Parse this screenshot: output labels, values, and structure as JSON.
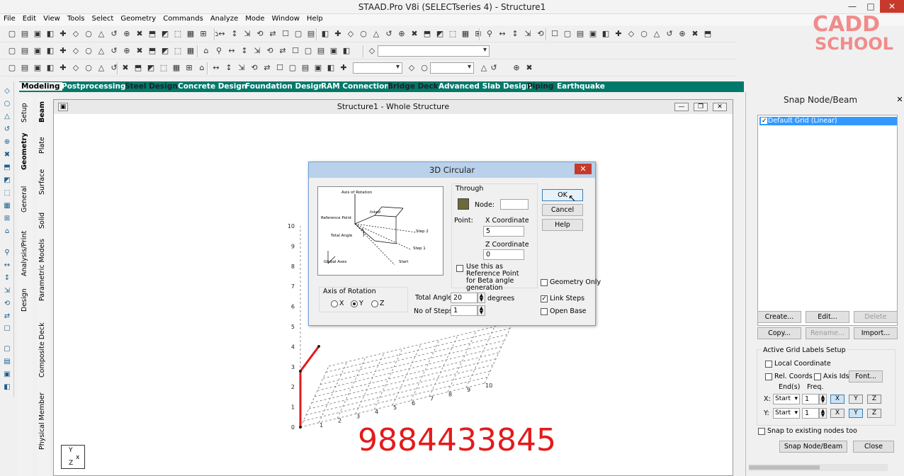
{
  "app": {
    "title": "STAAD.Pro V8i (SELECTseries 4) - Structure1"
  },
  "menu": [
    "File",
    "Edit",
    "View",
    "Tools",
    "Select",
    "Geometry",
    "Commands",
    "Analyze",
    "Mode",
    "Window",
    "Help"
  ],
  "logo": {
    "line1": "CADD",
    "line2": "SCHOOL"
  },
  "page_tabs": [
    "Modeling",
    "Postprocessing",
    "Steel Design",
    "Concrete Design",
    "Foundation Design",
    "RAM Connection",
    "Bridge Deck",
    "Advanced Slab Design",
    "Piping",
    "Earthquake"
  ],
  "side_tabs": {
    "outer": [
      "Setup",
      "Geometry",
      "General",
      "Analysis/Print",
      "Design"
    ],
    "inner": [
      "Beam",
      "Plate",
      "Surface",
      "Solid",
      "Parametric Models",
      "Composite Deck",
      "Physical Member"
    ]
  },
  "view": {
    "title": "Structure1 - Whole Structure",
    "y_axis_ticks": [
      "10",
      "9",
      "8",
      "7",
      "6",
      "5",
      "4",
      "3",
      "2",
      "1",
      "0"
    ],
    "x_axis_ticks": [
      "1",
      "2",
      "3",
      "4",
      "5",
      "6",
      "7",
      "8",
      "9",
      "10"
    ],
    "phone": "9884433845"
  },
  "dialog": {
    "title": "3D Circular",
    "diagram_labels": {
      "axis": "Axis of Rotation",
      "ref": "Reference Point",
      "total": "Total Angle",
      "linked": "linked",
      "step2": "Step 2",
      "step1": "Step 1",
      "start": "Start",
      "global": "Global Axes"
    },
    "through_label": "Through",
    "node_label": "Node:",
    "point_label": "Point:",
    "x_coord_label": "X Coordinate",
    "x_coord_value": "5",
    "z_coord_label": "Z Coordinate",
    "z_coord_value": "0",
    "ref_check_label": "Use this as Reference Point for Beta angle generation",
    "axis_group_label": "Axis of Rotation",
    "axis_options": [
      "X",
      "Y",
      "Z"
    ],
    "axis_selected": "Y",
    "total_angle_label": "Total Angle:",
    "total_angle_value": "20",
    "degrees_label": "degrees",
    "steps_label": "No of Steps:",
    "steps_value": "1",
    "geometry_only_label": "Geometry Only",
    "link_steps_label": "Link Steps",
    "open_base_label": "Open Base",
    "ok_label": "OK",
    "cancel_label": "Cancel",
    "help_label": "Help"
  },
  "snap": {
    "title": "Snap Node/Beam",
    "grid_item": "Default Grid (Linear)",
    "create": "Create...",
    "edit": "Edit...",
    "delete": "Delete",
    "copy": "Copy...",
    "rename": "Rename...",
    "import": "Import...",
    "active_grid_label": "Active Grid Labels Setup",
    "local_coord": "Local Coordinate",
    "rel_coords": "Rel. Coords",
    "axis_ids": "Axis Ids",
    "font": "Font...",
    "ends_label": "End(s)",
    "freq_label": "Freq.",
    "x_label": "X:",
    "y_label": "Y:",
    "x_end": "Start",
    "x_freq": "1",
    "y_end": "Start",
    "y_freq": "1",
    "snap_existing": "Snap to existing nodes too",
    "snap_button": "Snap Node/Beam",
    "close_button": "Close"
  }
}
